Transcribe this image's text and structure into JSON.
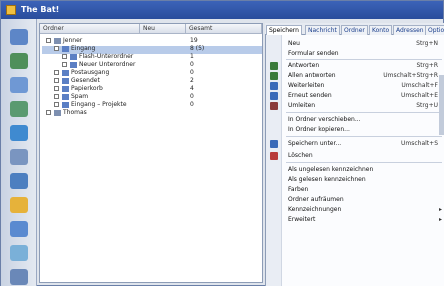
{
  "window": {
    "title": "The Bat!"
  },
  "tree": {
    "columns": [
      "Ordner",
      "Neu",
      "Gesamt"
    ],
    "rows": [
      {
        "name": "Jenner",
        "neu": "",
        "gesamt": "19",
        "level": 0,
        "selected": false
      },
      {
        "name": "Eingang",
        "neu": "",
        "gesamt": "8 (5)",
        "level": 1,
        "selected": true
      },
      {
        "name": "Flash-Unterordner",
        "neu": "",
        "gesamt": "1",
        "level": 2,
        "selected": false
      },
      {
        "name": "Neuer Unterordner",
        "neu": "",
        "gesamt": "0",
        "level": 2,
        "selected": false
      },
      {
        "name": "Postausgang",
        "neu": "",
        "gesamt": "0",
        "level": 1,
        "selected": false
      },
      {
        "name": "Gesendet",
        "neu": "",
        "gesamt": "2",
        "level": 1,
        "selected": false
      },
      {
        "name": "Papierkorb",
        "neu": "",
        "gesamt": "4",
        "level": 1,
        "selected": false
      },
      {
        "name": "Spam",
        "neu": "",
        "gesamt": "0",
        "level": 1,
        "selected": false
      },
      {
        "name": "Eingang – Projekte",
        "neu": "",
        "gesamt": "0",
        "level": 1,
        "selected": false
      },
      {
        "name": "Thomas",
        "neu": "",
        "gesamt": "",
        "level": 0,
        "selected": false
      }
    ]
  },
  "menu": {
    "tabs": [
      "Speichern",
      "Nachricht",
      "Ordner",
      "Konto",
      "Adressen",
      "Optionen"
    ],
    "items": [
      {
        "label": "Neu",
        "shortcut": "Strg+N",
        "icon_color": ""
      },
      {
        "label": "Formular senden",
        "shortcut": "",
        "icon_color": ""
      },
      {
        "label": "Antworten",
        "shortcut": "Strg+R",
        "icon_color": "#3a7a3a"
      },
      {
        "label": "Allen antworten",
        "shortcut": "Umschalt+Strg+R",
        "icon_color": "#3a7a3a"
      },
      {
        "label": "Weiterleiten",
        "shortcut": "Umschalt+F",
        "icon_color": "#3a6ab8"
      },
      {
        "label": "Erneut senden",
        "shortcut": "Umschalt+E",
        "icon_color": "#3a6ab8"
      },
      {
        "label": "Umleiten",
        "shortcut": "Strg+U",
        "icon_color": "#8a3a3a"
      },
      {
        "label": "In Ordner verschieben...",
        "shortcut": "",
        "icon_color": ""
      },
      {
        "label": "In Ordner kopieren...",
        "shortcut": "",
        "icon_color": ""
      },
      {
        "label": "Speichern unter...",
        "shortcut": "Umschalt+S",
        "icon_color": "#3a6ab8"
      },
      {
        "label": "Löschen",
        "shortcut": "",
        "icon_color": "#b83a3a"
      },
      {
        "label": "Als ungelesen kennzeichnen",
        "shortcut": "",
        "icon_color": ""
      },
      {
        "label": "Als gelesen kennzeichnen",
        "shortcut": "",
        "icon_color": ""
      },
      {
        "label": "Farben",
        "shortcut": "",
        "icon_color": ""
      },
      {
        "label": "Ordner aufräumen",
        "shortcut": "",
        "icon_color": ""
      },
      {
        "label": "Kennzeichnungen",
        "shortcut": "",
        "icon_color": ""
      },
      {
        "label": "Erweitert",
        "shortcut": "",
        "icon_color": ""
      }
    ]
  }
}
